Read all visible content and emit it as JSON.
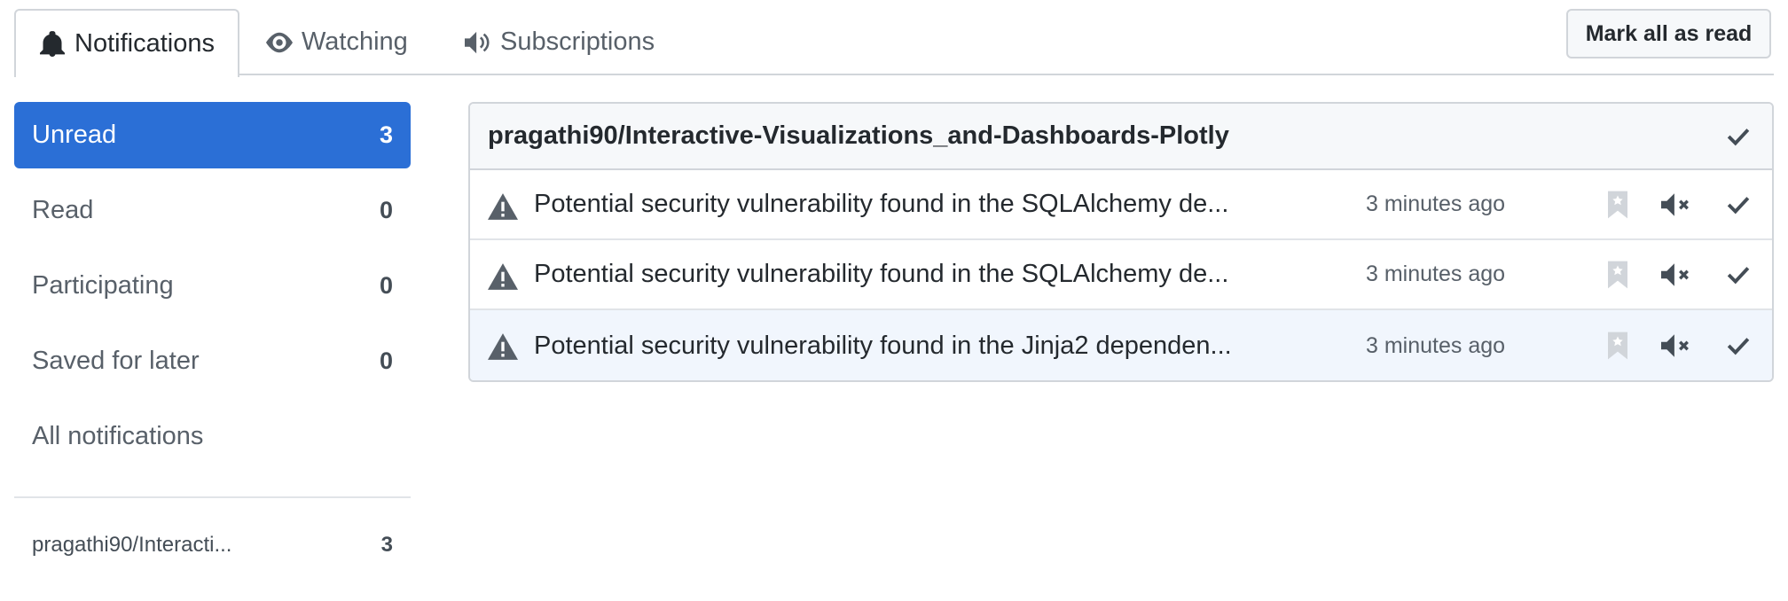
{
  "tabs": [
    {
      "label": "Notifications",
      "icon": "bell-icon"
    },
    {
      "label": "Watching",
      "icon": "eye-icon"
    },
    {
      "label": "Subscriptions",
      "icon": "megaphone-icon"
    }
  ],
  "actions": {
    "mark_all_read": "Mark all as read"
  },
  "sidebar": {
    "filters": [
      {
        "label": "Unread",
        "count": "3"
      },
      {
        "label": "Read",
        "count": "0"
      },
      {
        "label": "Participating",
        "count": "0"
      },
      {
        "label": "Saved for later",
        "count": "0"
      },
      {
        "label": "All notifications",
        "count": ""
      }
    ],
    "repos": [
      {
        "label": "pragathi90/Interacti...",
        "count": "3"
      }
    ]
  },
  "group": {
    "repo": "pragathi90/Interactive-Visualizations_and-Dashboards-Plotly",
    "notifications": [
      {
        "title": "Potential security vulnerability found in the SQLAlchemy de...",
        "time": "3 minutes ago"
      },
      {
        "title": "Potential security vulnerability found in the SQLAlchemy de...",
        "time": "3 minutes ago"
      },
      {
        "title": "Potential security vulnerability found in the Jinja2 dependen...",
        "time": "3 minutes ago"
      }
    ]
  },
  "colors": {
    "accent": "#2b6fd6",
    "border": "#d1d5da",
    "muted": "#586069"
  }
}
